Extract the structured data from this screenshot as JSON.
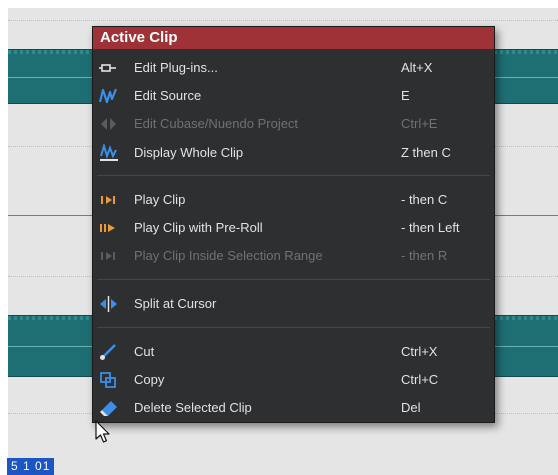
{
  "menu": {
    "title": "Active Clip",
    "groups": [
      [
        {
          "label": "Edit Plug-ins...",
          "shortcut": "Alt+X",
          "icon": "plugin-icon",
          "enabled": true
        },
        {
          "label": "Edit Source",
          "shortcut": "E",
          "icon": "waveform-icon",
          "enabled": true
        },
        {
          "label": "Edit Cubase/Nuendo Project",
          "shortcut": "Ctrl+E",
          "icon": "project-icon",
          "enabled": false
        },
        {
          "label": "Display Whole Clip",
          "shortcut": "Z then C",
          "icon": "zoom-clip-icon",
          "enabled": true
        }
      ],
      [
        {
          "label": "Play Clip",
          "shortcut": "- then C",
          "icon": "play-clip-icon",
          "enabled": true
        },
        {
          "label": "Play Clip with Pre-Roll",
          "shortcut": "- then Left",
          "icon": "play-preroll-icon",
          "enabled": true
        },
        {
          "label": "Play Clip Inside Selection Range",
          "shortcut": "- then R",
          "icon": "play-range-icon",
          "enabled": false
        }
      ],
      [
        {
          "label": "Split at Cursor",
          "shortcut": "",
          "icon": "split-icon",
          "enabled": true
        }
      ],
      [
        {
          "label": "Cut",
          "shortcut": "Ctrl+X",
          "icon": "cut-icon",
          "enabled": true
        },
        {
          "label": "Copy",
          "shortcut": "Ctrl+C",
          "icon": "copy-icon",
          "enabled": true
        },
        {
          "label": "Delete Selected Clip",
          "shortcut": "Del",
          "icon": "eraser-icon",
          "enabled": true
        }
      ]
    ]
  },
  "timeline": {
    "position_readout": "5 1 01"
  },
  "colors": {
    "menu_title_bg": "#9e3236",
    "menu_bg": "#2d2f31",
    "clip": "#1e6f73",
    "icon_blue": "#3c8ee6",
    "icon_orange": "#e89a3c",
    "badge": "#1c55c4"
  }
}
